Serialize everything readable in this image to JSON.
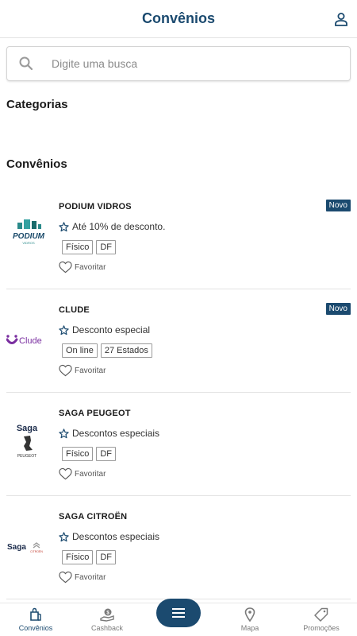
{
  "header": {
    "title": "Convênios"
  },
  "search": {
    "placeholder": "Digite uma busca"
  },
  "sections": {
    "categories": "Categorias",
    "agreements": "Convênios"
  },
  "colors": {
    "brand": "#1b4a6f",
    "podium": "#1a6b6b",
    "clude": "#7a2ea0"
  },
  "logos": {
    "podium": {
      "text": "PODIUM",
      "sub": "VIDROS"
    },
    "clude": {
      "text": "Clude"
    },
    "saga_peugeot": {
      "line1": "Saga",
      "line2": "PEUGEOT"
    },
    "saga_citroen": {
      "line1": "Saga",
      "line2": "CITROËN"
    }
  },
  "cards": [
    {
      "name": "PODIUM VIDROS",
      "badge": "Novo",
      "discount": "Até 10% de desconto.",
      "tags": [
        "Físico",
        "DF"
      ],
      "favorite_label": "Favoritar"
    },
    {
      "name": "CLUDE",
      "badge": "Novo",
      "discount": "Desconto especial",
      "tags": [
        "On line",
        "27 Estados"
      ],
      "favorite_label": "Favoritar"
    },
    {
      "name": "SAGA PEUGEOT",
      "discount": "Descontos especiais",
      "tags": [
        "Físico",
        "DF"
      ],
      "favorite_label": "Favoritar"
    },
    {
      "name": "SAGA CITROËN",
      "discount": "Descontos especiais",
      "tags": [
        "Físico",
        "DF"
      ],
      "favorite_label": "Favoritar"
    }
  ],
  "nav": {
    "items": [
      {
        "label": "Convênios",
        "icon": "shopping-bag-icon",
        "active": true
      },
      {
        "label": "Cashback",
        "icon": "cashback-icon"
      },
      {
        "label": "",
        "icon": "menu-icon"
      },
      {
        "label": "Mapa",
        "icon": "map-pin-icon"
      },
      {
        "label": "Promoções",
        "icon": "tag-icon"
      }
    ]
  }
}
